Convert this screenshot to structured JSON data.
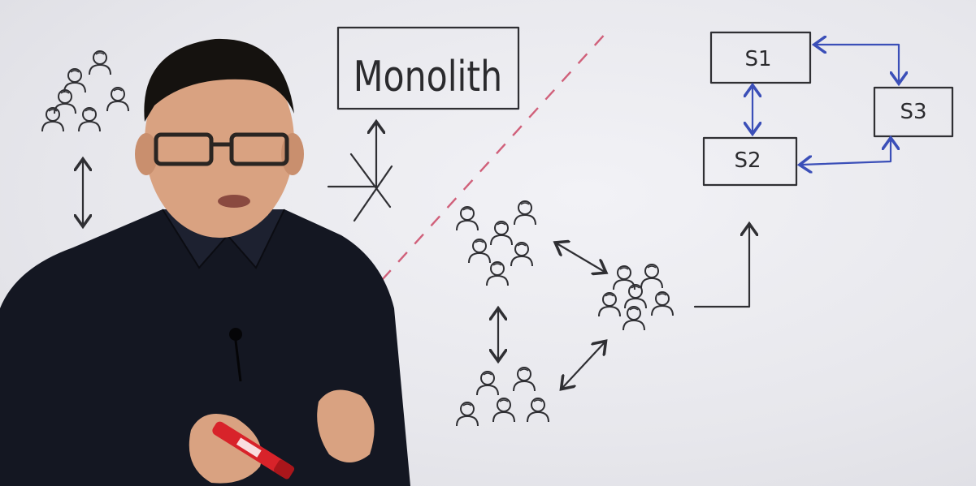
{
  "whiteboard": {
    "monolith_label": "Monolith",
    "services": {
      "s1": "S1",
      "s2": "S2",
      "s3": "S3"
    }
  },
  "colors": {
    "board": "#ececf0",
    "ink": "#2f2f33",
    "service_arrows": "#3b4fb8",
    "divider": "#d0607a",
    "shirt": "#141722",
    "marker": "#d8232a"
  }
}
